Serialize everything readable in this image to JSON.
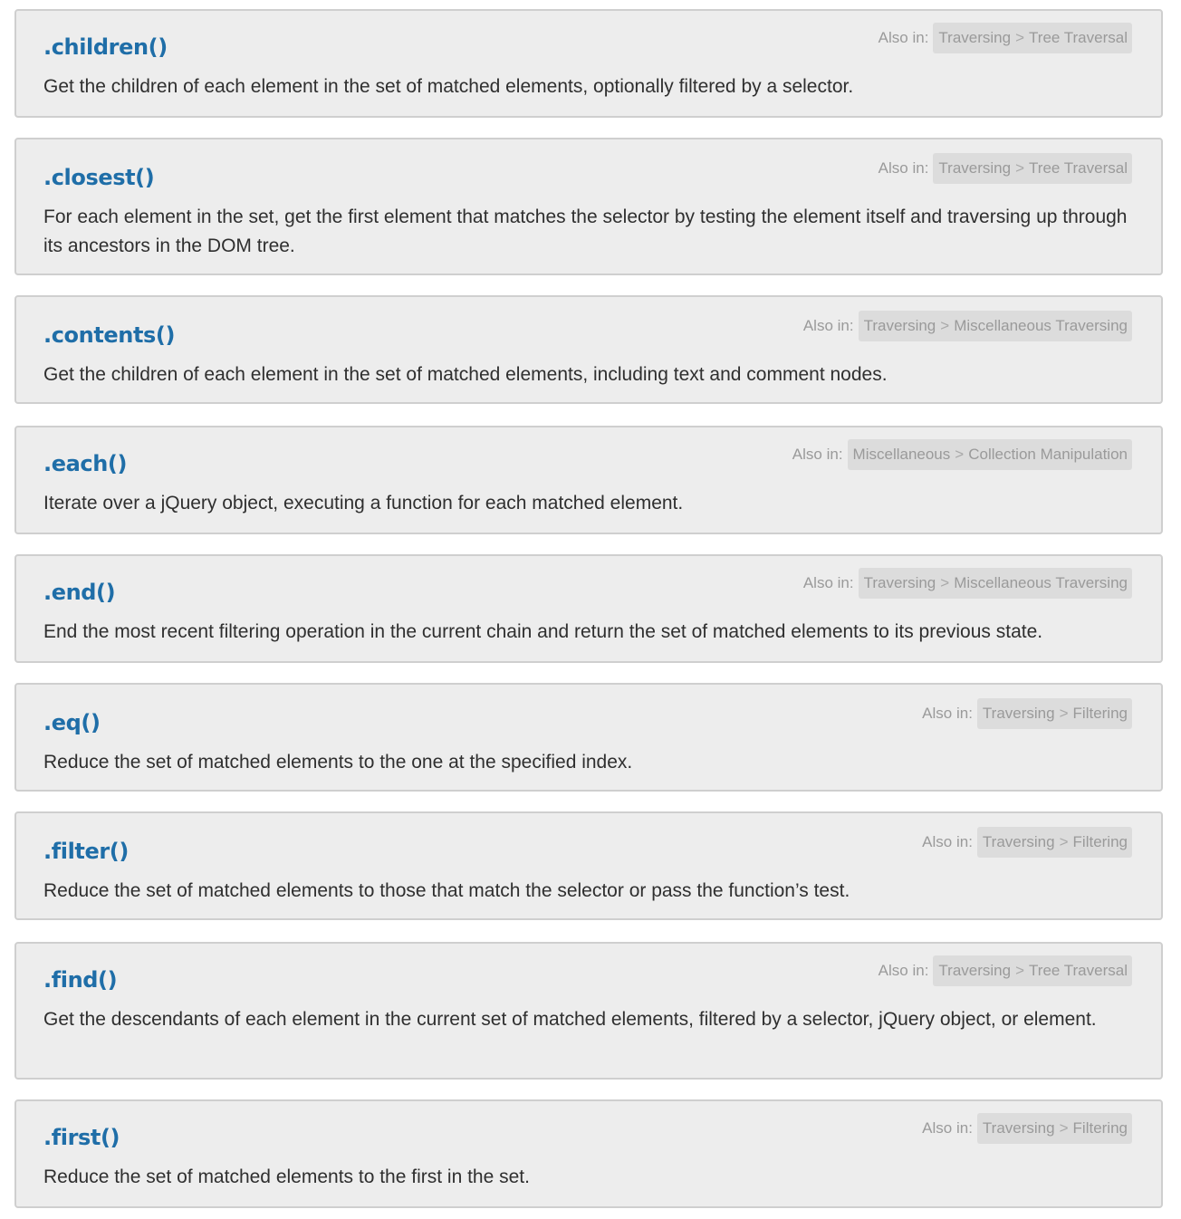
{
  "also_in_label": "Also in:",
  "separator": ">",
  "entries": [
    {
      "title": ".children()",
      "description": "Get the children of each element in the set of matched elements, optionally filtered by a selector.",
      "category": "Traversing",
      "subcategory": "Tree Traversal"
    },
    {
      "title": ".closest()",
      "description": "For each element in the set, get the first element that matches the selector by testing the element itself and traversing up through its ancestors in the DOM tree.",
      "category": "Traversing",
      "subcategory": "Tree Traversal"
    },
    {
      "title": ".contents()",
      "description": "Get the children of each element in the set of matched elements, including text and comment nodes.",
      "category": "Traversing",
      "subcategory": "Miscellaneous Traversing"
    },
    {
      "title": ".each()",
      "description": "Iterate over a jQuery object, executing a function for each matched element.",
      "category": "Miscellaneous",
      "subcategory": "Collection Manipulation"
    },
    {
      "title": ".end()",
      "description": "End the most recent filtering operation in the current chain and return the set of matched elements to its previous state.",
      "category": "Traversing",
      "subcategory": "Miscellaneous Traversing"
    },
    {
      "title": ".eq()",
      "description": "Reduce the set of matched elements to the one at the specified index.",
      "category": "Traversing",
      "subcategory": "Filtering"
    },
    {
      "title": ".filter()",
      "description": "Reduce the set of matched elements to those that match the selector or pass the function’s test.",
      "category": "Traversing",
      "subcategory": "Filtering"
    },
    {
      "title": ".find()",
      "description": "Get the descendants of each element in the current set of matched elements, filtered by a selector, jQuery object, or element.",
      "category": "Traversing",
      "subcategory": "Tree Traversal"
    },
    {
      "title": ".first()",
      "description": "Reduce the set of matched elements to the first in the set.",
      "category": "Traversing",
      "subcategory": "Filtering"
    }
  ]
}
